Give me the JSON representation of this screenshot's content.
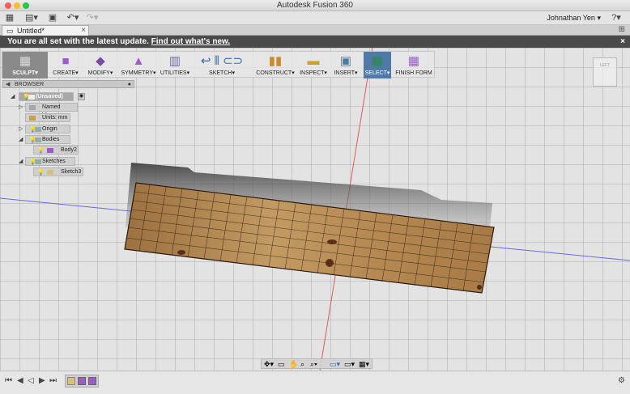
{
  "window": {
    "title": "Autodesk Fusion 360"
  },
  "user": {
    "name": "Johnathan Yen",
    "chevron": "▾",
    "help": "?"
  },
  "tab": {
    "label": "Untitled*",
    "close": "×"
  },
  "notification": {
    "message": "You are all set with the latest update.",
    "link": "Find out what's new.",
    "close": "×"
  },
  "toolbar": {
    "workspace": "SCULPT",
    "items": [
      {
        "label": "CREATE",
        "icon": "create-box-icon"
      },
      {
        "label": "MODIFY",
        "icon": "modify-icon"
      },
      {
        "label": "SYMMETRY",
        "icon": "symmetry-icon"
      },
      {
        "label": "UTILITIES",
        "icon": "utilities-icon"
      },
      {
        "label": "SKETCH",
        "icon": "sketch-icon"
      },
      {
        "label": "CONSTRUCT",
        "icon": "construct-icon"
      },
      {
        "label": "INSPECT",
        "icon": "inspect-icon"
      },
      {
        "label": "INSERT",
        "icon": "insert-icon"
      },
      {
        "label": "SELECT",
        "icon": "select-icon"
      },
      {
        "label": "FINISH FORM",
        "icon": "finish-form-icon"
      }
    ]
  },
  "browser": {
    "title": "BROWSER",
    "root": "(Unsaved)",
    "named_views": "Named Views",
    "units": "Units: mm",
    "origin": "Origin",
    "bodies": "Bodies",
    "body2": "Body2",
    "sketches": "Sketches",
    "sketch3": "Sketch3"
  },
  "viewcube": {
    "label": "LEFT"
  },
  "colors": {
    "accent": "#4f7aa6",
    "notification_bg": "#4a4a4a",
    "wood": "#b88a52"
  }
}
